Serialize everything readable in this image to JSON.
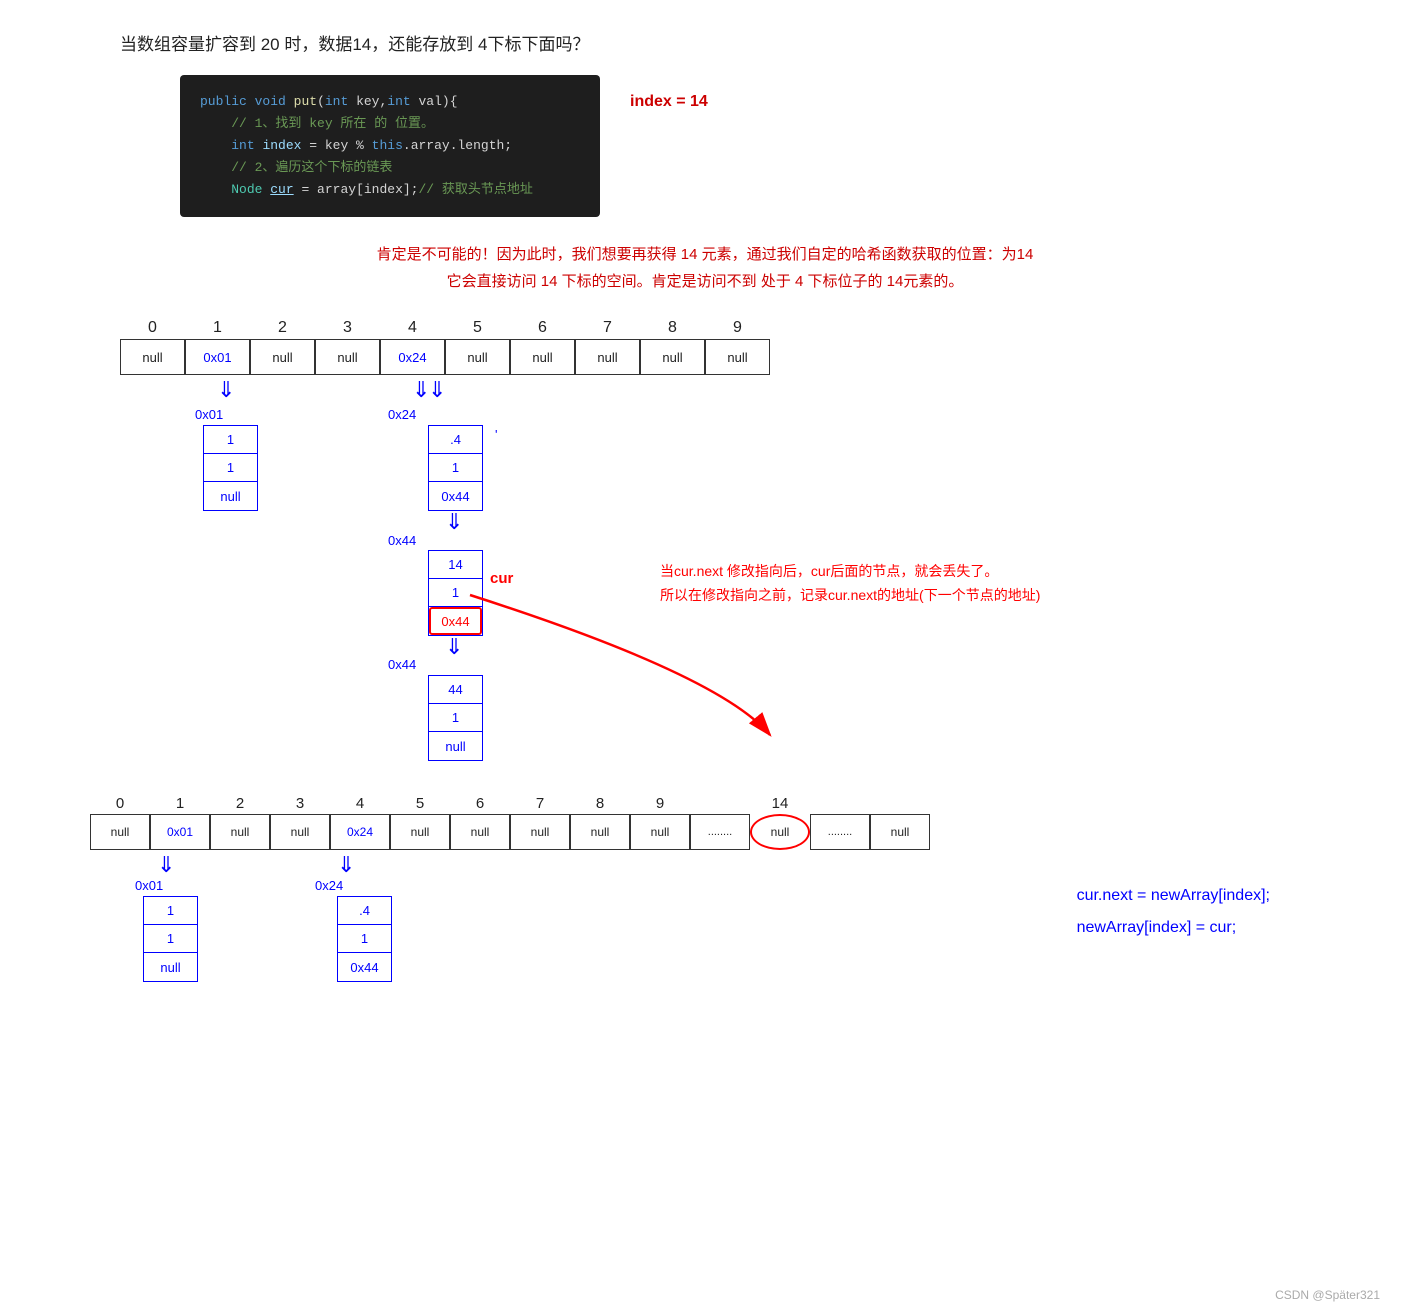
{
  "question": {
    "text": "当数组容量扩容到 20 时，数据14，还能存放到 4下标下面吗？"
  },
  "code": {
    "lines": [
      {
        "type": "normal",
        "text": "public void put(int key,int val){"
      },
      {
        "type": "comment",
        "text": "    // 1、找到 key 所在 的 位置。"
      },
      {
        "type": "normal",
        "text": "    int index = key % this.array.length;"
      },
      {
        "type": "comment",
        "text": "    // 2、遍历这个下标的链表"
      },
      {
        "type": "normal",
        "text": "    Node cur = array[index];// 获取头节点地址"
      }
    ]
  },
  "index_label": "index = 14",
  "red_paragraph": {
    "line1": "肯定是不可能的！因为此时，我们想要再获得 14 元素，通过我们自定的哈希函数获取的位置：为14",
    "line2": "它会直接访问 14 下标的空间。肯定是访问不到 处于 4 下标位子的 14元素的。"
  },
  "array1": {
    "indices": [
      "0",
      "1",
      "2",
      "3",
      "4",
      "5",
      "6",
      "7",
      "8",
      "9"
    ],
    "cells": [
      "null",
      "0x01",
      "null",
      "null",
      "0x24",
      "null",
      "null",
      "null",
      "null",
      "null"
    ]
  },
  "nodes_top": {
    "node_0x01": {
      "label": "0x01",
      "cells": [
        "1",
        "1",
        "null"
      ]
    },
    "node_0x24_label": "0x24",
    "node_0x24": {
      "cells": [
        ".4",
        "1",
        "0x44"
      ]
    },
    "node_0x44_label": "0x44",
    "node_0x44_data": {
      "cells": [
        "14",
        "1",
        "0x44"
      ],
      "highlight_cell": "0x44"
    },
    "node_0x44_tail_label": "0x44",
    "node_0x44_tail": {
      "cells": [
        "44",
        "1",
        "null"
      ]
    },
    "cur_label": "cur"
  },
  "red_comment": {
    "line1": "当cur.next 修改指向后，cur后面的节点，就会丢失了。",
    "line2": "所以在修改指向之前，记录cur.next的地址(下一个节点的地址)"
  },
  "array2": {
    "indices": [
      "0",
      "1",
      "2",
      "3",
      "4",
      "5",
      "6",
      "7",
      "8",
      "9",
      "........",
      "14",
      "........",
      ""
    ],
    "cells": [
      "null",
      "0x01",
      "null",
      "null",
      "0x24",
      "null",
      "null",
      "null",
      "null",
      "null",
      "........",
      "null",
      "........",
      "null"
    ],
    "circle_index": 11
  },
  "nodes_bottom": {
    "node_0x01": {
      "label": "0x01",
      "cells": [
        "1",
        "1",
        "null"
      ]
    },
    "node_0x24_label": "0x24",
    "node_0x24": {
      "cells": [
        ".4",
        "1",
        "0x44"
      ]
    }
  },
  "bottom_code": {
    "line1": "cur.next = newArray[index];",
    "line2": "newArray[index] = cur;"
  },
  "watermark": "CSDN @Später321"
}
